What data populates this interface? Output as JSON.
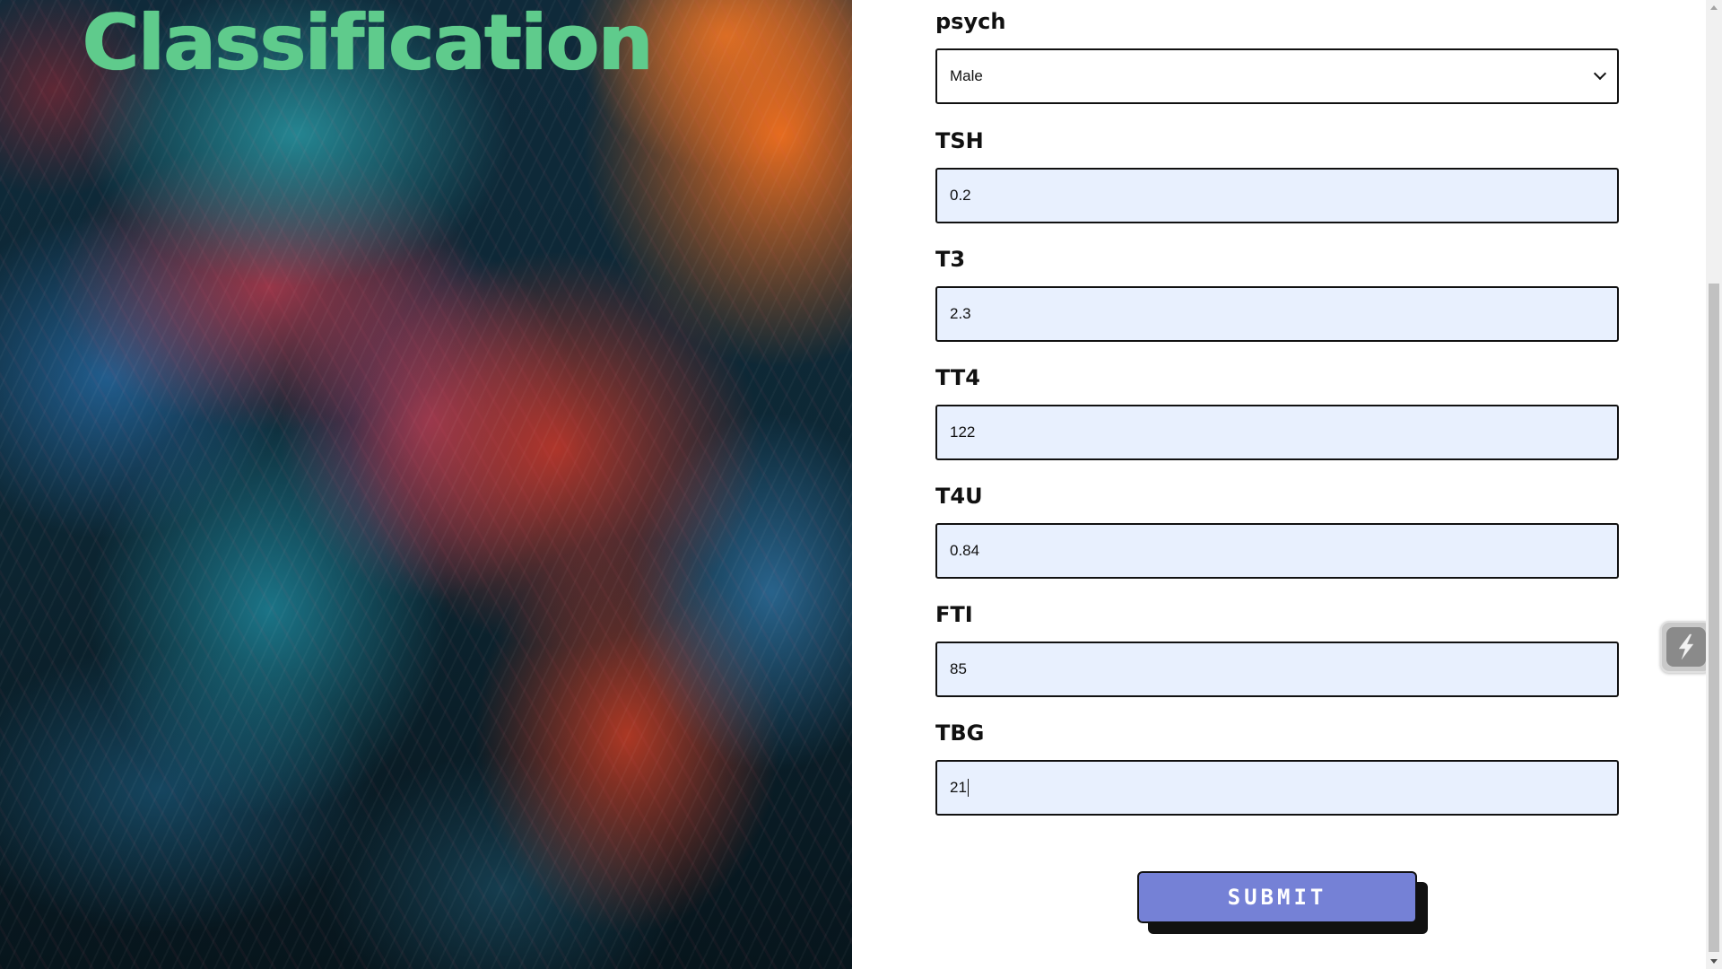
{
  "page": {
    "title": "Classification"
  },
  "form": {
    "fields": [
      {
        "label": "psych",
        "type": "select",
        "value": "Male"
      },
      {
        "label": "TSH",
        "type": "text",
        "value": "0.2"
      },
      {
        "label": "T3",
        "type": "text",
        "value": "2.3"
      },
      {
        "label": "TT4",
        "type": "text",
        "value": "122"
      },
      {
        "label": "T4U",
        "type": "text",
        "value": "0.84"
      },
      {
        "label": "FTI",
        "type": "text",
        "value": "85"
      },
      {
        "label": "TBG",
        "type": "text",
        "value": "21",
        "focused": true
      }
    ],
    "submit_label": "SUBMIT"
  },
  "widget": {
    "icon": "lightning-bolt-icon"
  },
  "colors": {
    "title": "#5fcb8c",
    "submit_button": "#7581d6",
    "input_background": "#e8f0fe"
  }
}
